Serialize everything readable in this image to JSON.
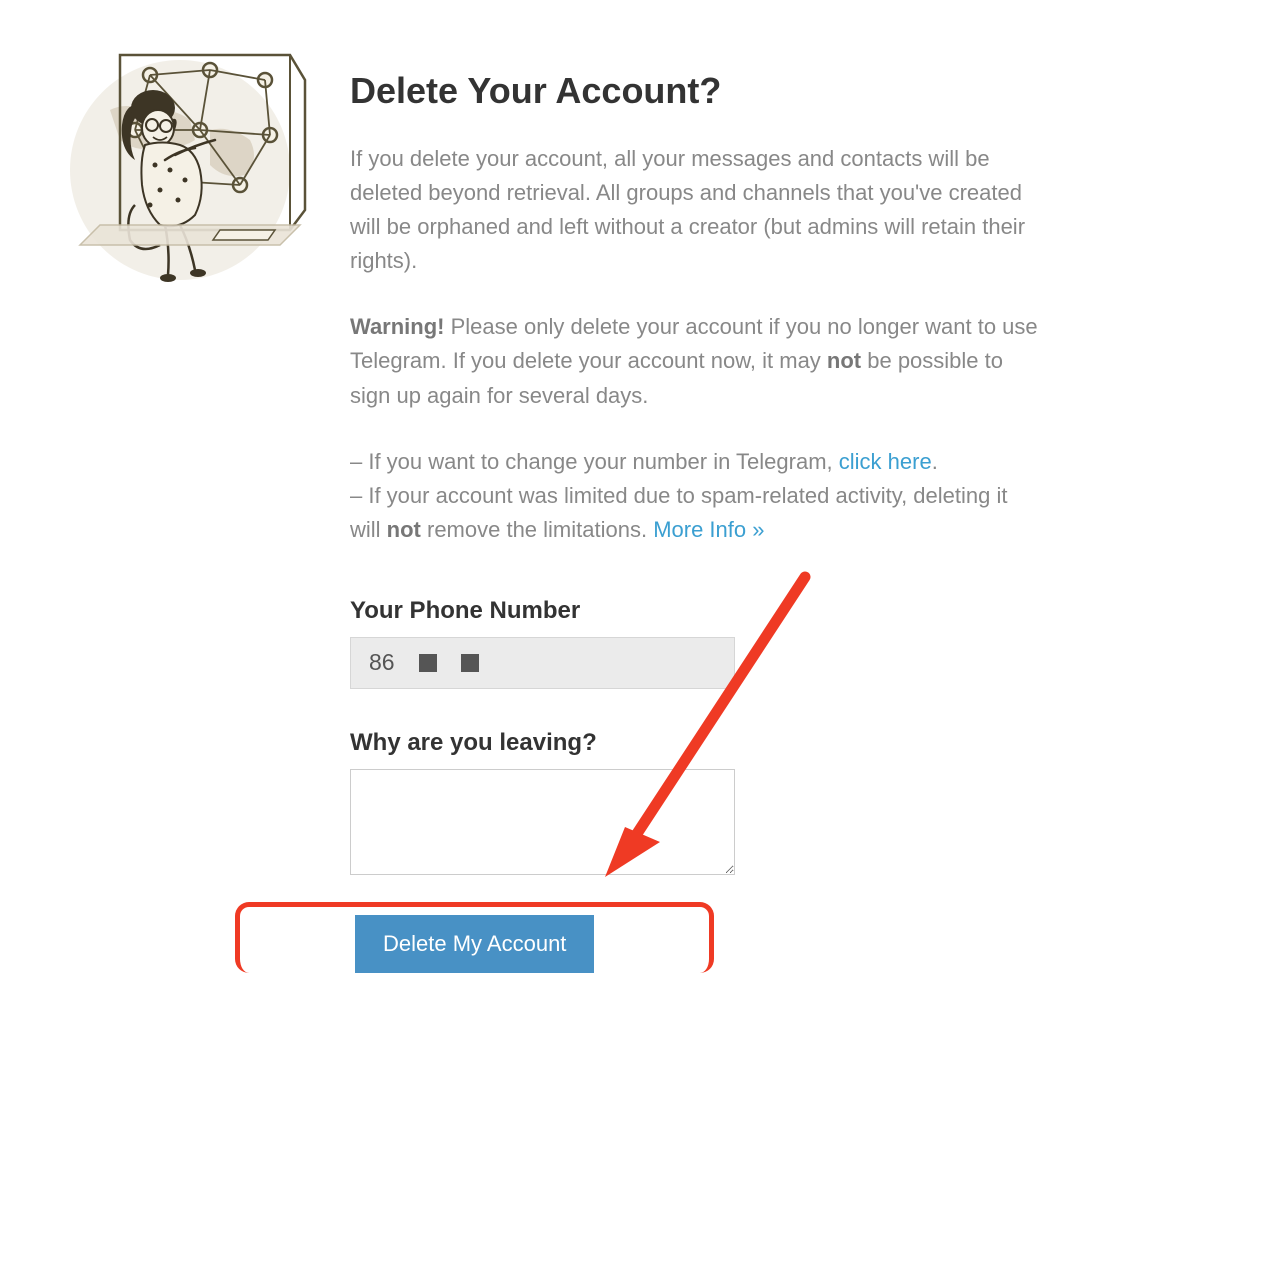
{
  "heading": "Delete Your Account?",
  "para1": "If you delete your account, all your messages and contacts will be deleted beyond retrieval. All groups and channels that you've created will be orphaned and left without a creator (but admins will retain their rights).",
  "para2_prefix": "Warning!",
  "para2_body1": " Please only delete your account if you no longer want to use Telegram. If you delete your account now, it may ",
  "para2_not": "not",
  "para2_body2": " be possible to sign up again for several days.",
  "para3_line1_prefix": "– If you want to change your number in Telegram, ",
  "para3_link1": "click here",
  "para3_line1_suffix": ".",
  "para3_line2_prefix": "– If your account was limited due to spam-related activity, deleting it will ",
  "para3_not": "not",
  "para3_line2_suffix": " remove the limitations. ",
  "para3_link2": "More Info »",
  "form": {
    "phone_label": "Your Phone Number",
    "phone_value": "86",
    "reason_label": "Why are you leaving?",
    "reason_value": "",
    "delete_button_label": "Delete My Account"
  },
  "annotation": {
    "highlight_color": "#ef3a24",
    "arrow_points_to": "delete-button"
  }
}
